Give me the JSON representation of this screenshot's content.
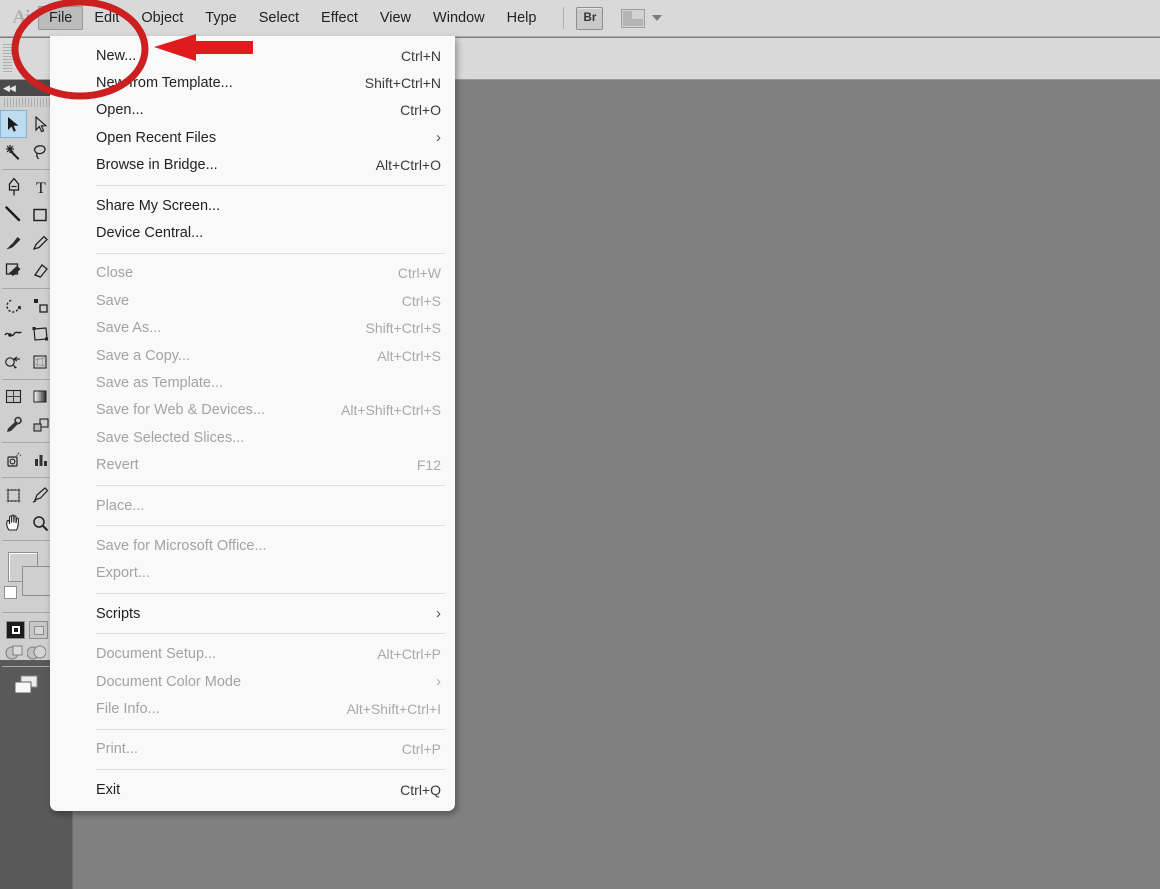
{
  "app": {
    "name": "Adobe Illustrator",
    "logo_text": "Ai"
  },
  "menubar": {
    "items": [
      {
        "label": "File",
        "active": true
      },
      {
        "label": "Edit",
        "active": false
      },
      {
        "label": "Object",
        "active": false
      },
      {
        "label": "Type",
        "active": false
      },
      {
        "label": "Select",
        "active": false
      },
      {
        "label": "Effect",
        "active": false
      },
      {
        "label": "View",
        "active": false
      },
      {
        "label": "Window",
        "active": false
      },
      {
        "label": "Help",
        "active": false
      }
    ],
    "bridge_button_label": "Br",
    "bridge_icon_name": "bridge-icon",
    "workspace_switcher_icon": "workspace-layout-icon",
    "workspace_caret_icon": "chevron-down-icon"
  },
  "file_menu": {
    "rows": [
      {
        "type": "item",
        "label": "New...",
        "accel": "Ctrl+N",
        "disabled": false,
        "submenu": false
      },
      {
        "type": "item",
        "label": "New from Template...",
        "accel": "Shift+Ctrl+N",
        "disabled": false,
        "submenu": false
      },
      {
        "type": "item",
        "label": "Open...",
        "accel": "Ctrl+O",
        "disabled": false,
        "submenu": false
      },
      {
        "type": "item",
        "label": "Open Recent Files",
        "accel": "",
        "disabled": false,
        "submenu": true
      },
      {
        "type": "item",
        "label": "Browse in Bridge...",
        "accel": "Alt+Ctrl+O",
        "disabled": false,
        "submenu": false
      },
      {
        "type": "separator"
      },
      {
        "type": "item",
        "label": "Share My Screen...",
        "accel": "",
        "disabled": false,
        "submenu": false
      },
      {
        "type": "item",
        "label": "Device Central...",
        "accel": "",
        "disabled": false,
        "submenu": false
      },
      {
        "type": "separator"
      },
      {
        "type": "item",
        "label": "Close",
        "accel": "Ctrl+W",
        "disabled": true,
        "submenu": false
      },
      {
        "type": "item",
        "label": "Save",
        "accel": "Ctrl+S",
        "disabled": true,
        "submenu": false
      },
      {
        "type": "item",
        "label": "Save As...",
        "accel": "Shift+Ctrl+S",
        "disabled": true,
        "submenu": false
      },
      {
        "type": "item",
        "label": "Save a Copy...",
        "accel": "Alt+Ctrl+S",
        "disabled": true,
        "submenu": false
      },
      {
        "type": "item",
        "label": "Save as Template...",
        "accel": "",
        "disabled": true,
        "submenu": false
      },
      {
        "type": "item",
        "label": "Save for Web & Devices...",
        "accel": "Alt+Shift+Ctrl+S",
        "disabled": true,
        "submenu": false
      },
      {
        "type": "item",
        "label": "Save Selected Slices...",
        "accel": "",
        "disabled": true,
        "submenu": false
      },
      {
        "type": "item",
        "label": "Revert",
        "accel": "F12",
        "disabled": true,
        "submenu": false
      },
      {
        "type": "separator"
      },
      {
        "type": "item",
        "label": "Place...",
        "accel": "",
        "disabled": true,
        "submenu": false
      },
      {
        "type": "separator"
      },
      {
        "type": "item",
        "label": "Save for Microsoft Office...",
        "accel": "",
        "disabled": true,
        "submenu": false
      },
      {
        "type": "item",
        "label": "Export...",
        "accel": "",
        "disabled": true,
        "submenu": false
      },
      {
        "type": "separator"
      },
      {
        "type": "item",
        "label": "Scripts",
        "accel": "",
        "disabled": false,
        "submenu": true
      },
      {
        "type": "separator"
      },
      {
        "type": "item",
        "label": "Document Setup...",
        "accel": "Alt+Ctrl+P",
        "disabled": true,
        "submenu": false
      },
      {
        "type": "item",
        "label": "Document Color Mode",
        "accel": "",
        "disabled": true,
        "submenu": true
      },
      {
        "type": "item",
        "label": "File Info...",
        "accel": "Alt+Shift+Ctrl+I",
        "disabled": true,
        "submenu": false
      },
      {
        "type": "separator"
      },
      {
        "type": "item",
        "label": "Print...",
        "accel": "Ctrl+P",
        "disabled": true,
        "submenu": false
      },
      {
        "type": "separator"
      },
      {
        "type": "item",
        "label": "Exit",
        "accel": "Ctrl+Q",
        "disabled": false,
        "submenu": false
      }
    ],
    "submenu_arrow_glyph": "›"
  },
  "toolbar": {
    "collapse_glyph": "◀◀",
    "tools": [
      {
        "name": "selection-tool",
        "selected": true
      },
      {
        "name": "direct-selection-tool",
        "selected": false
      },
      {
        "name": "magic-wand-tool",
        "selected": false
      },
      {
        "name": "lasso-tool",
        "selected": false
      },
      {
        "name": "pen-tool",
        "selected": false
      },
      {
        "name": "type-tool",
        "selected": false
      },
      {
        "name": "line-segment-tool",
        "selected": false
      },
      {
        "name": "rectangle-tool",
        "selected": false
      },
      {
        "name": "paintbrush-tool",
        "selected": false
      },
      {
        "name": "pencil-tool",
        "selected": false
      },
      {
        "name": "blob-brush-tool",
        "selected": false
      },
      {
        "name": "eraser-tool",
        "selected": false
      },
      {
        "name": "rotate-tool",
        "selected": false
      },
      {
        "name": "scale-tool",
        "selected": false
      },
      {
        "name": "width-tool",
        "selected": false
      },
      {
        "name": "free-transform-tool",
        "selected": false
      },
      {
        "name": "shape-builder-tool",
        "selected": false
      },
      {
        "name": "perspective-grid-tool",
        "selected": false
      },
      {
        "name": "mesh-tool",
        "selected": false
      },
      {
        "name": "gradient-tool",
        "selected": false
      },
      {
        "name": "eyedropper-tool",
        "selected": false
      },
      {
        "name": "blend-tool",
        "selected": false
      },
      {
        "name": "symbol-sprayer-tool",
        "selected": false
      },
      {
        "name": "column-graph-tool",
        "selected": false
      },
      {
        "name": "artboard-tool",
        "selected": false
      },
      {
        "name": "slice-tool",
        "selected": false
      },
      {
        "name": "hand-tool",
        "selected": false
      },
      {
        "name": "zoom-tool",
        "selected": false
      }
    ],
    "fill_swatch_name": "fill-swatch",
    "stroke_swatch_name": "stroke-swatch",
    "draw_modes": [
      "draw-normal-mode",
      "draw-behind-mode"
    ],
    "screen_modes": [
      "screen-mode-normal",
      "screen-mode-full"
    ],
    "change_screen_mode_name": "change-screen-mode-button"
  },
  "annotations": {
    "circle": {
      "name": "red-circle-highlight",
      "color": "#cc1f1f"
    },
    "arrow": {
      "name": "red-arrow-pointer",
      "color": "#e01b1b"
    }
  },
  "colors": {
    "chrome": "#d9d9d9",
    "canvas": "#808080",
    "canvas_dark": "#595959",
    "menu_bg": "#f9f9f9",
    "accent_red": "#cc1f1f",
    "selection_blue": "#bddcf0"
  }
}
